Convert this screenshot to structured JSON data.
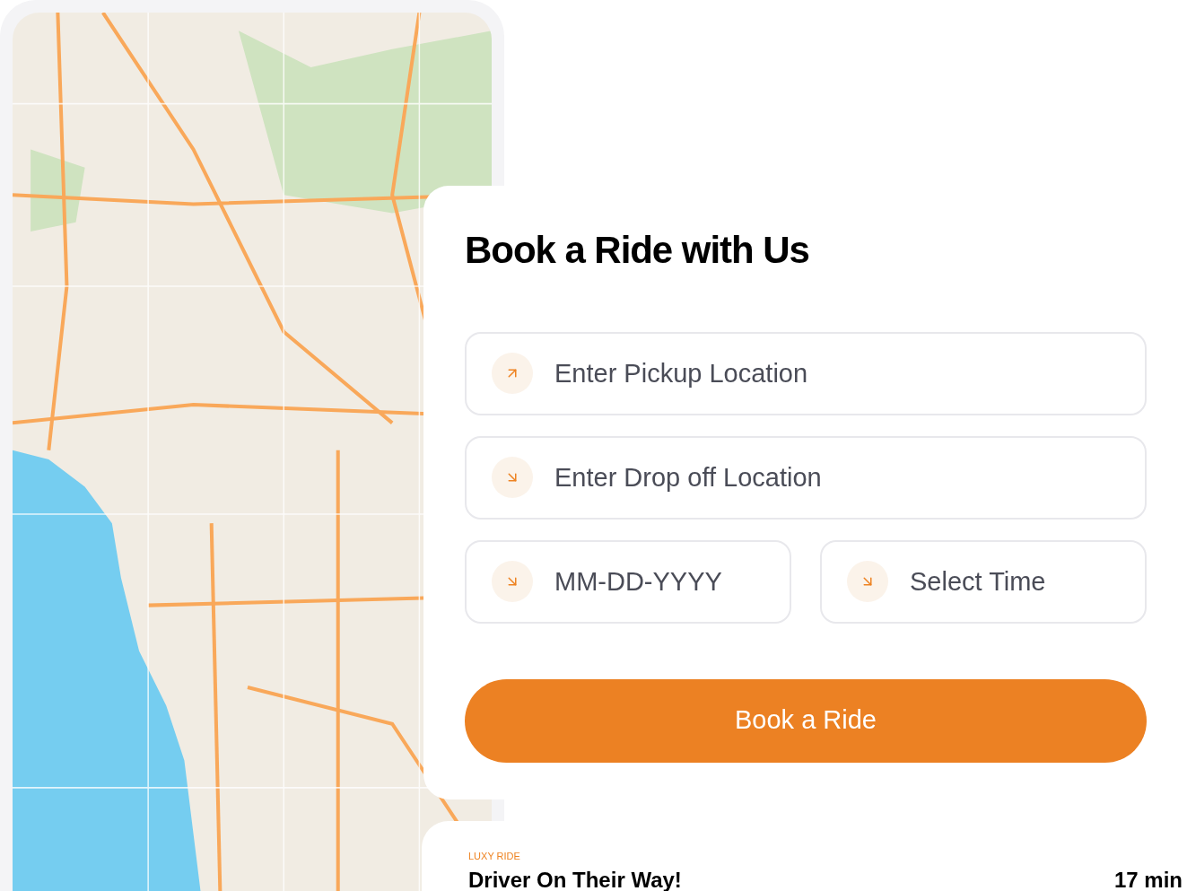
{
  "booking": {
    "title": "Book a Ride with Us",
    "fields": [
      {
        "placeholder": "Enter Pickup Location",
        "kind": "pickup"
      },
      {
        "placeholder": "Enter Drop off Location",
        "kind": "dropoff"
      }
    ],
    "half_fields": [
      {
        "placeholder": "MM-DD-YYYY"
      },
      {
        "placeholder": "Select Time"
      }
    ],
    "button": "Book a Ride"
  },
  "status_card": {
    "tag": "LUXY RIDE",
    "title": "Driver On Their Way!",
    "eta": "17 min"
  }
}
